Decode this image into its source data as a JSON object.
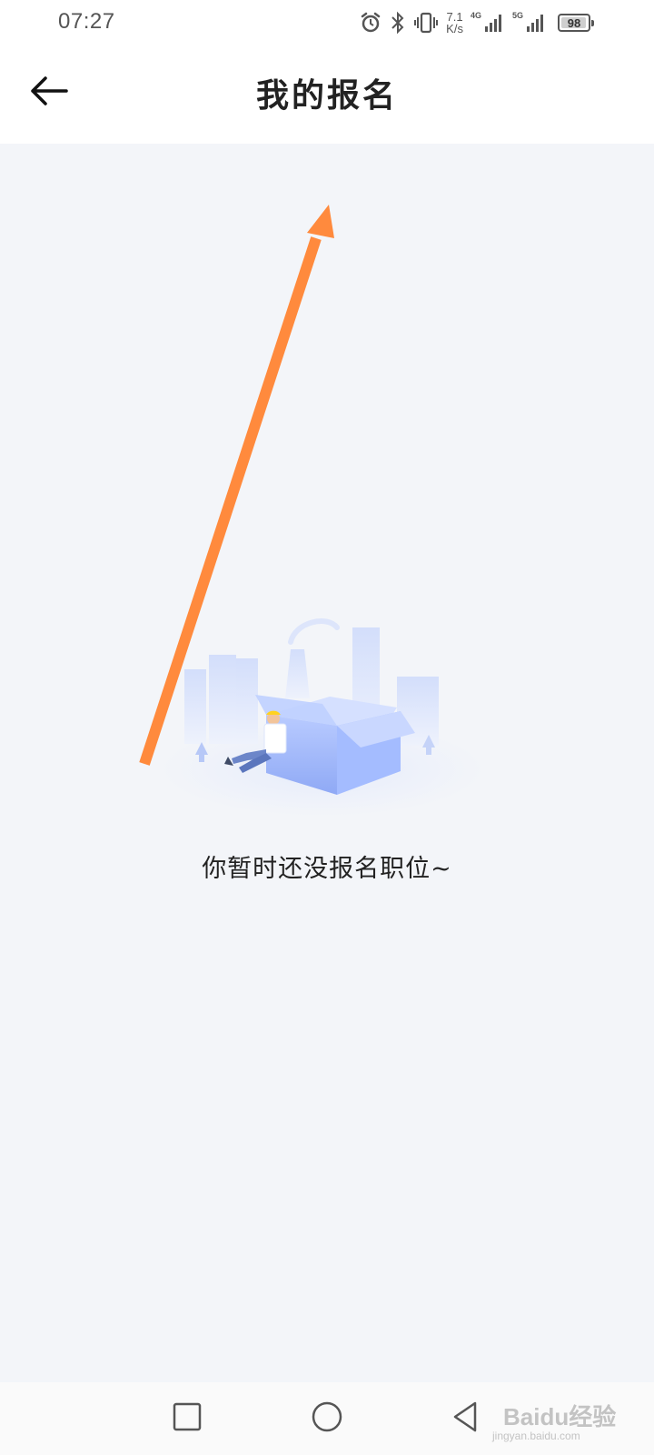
{
  "status_bar": {
    "time": "07:27",
    "net_speed_value": "7.1",
    "net_speed_unit": "K/s",
    "signal1_label": "4G",
    "signal2_label": "5G",
    "battery_level": "98",
    "icons": [
      "alarm-icon",
      "bluetooth-icon",
      "vibrate-icon",
      "signal-icon",
      "signal-icon",
      "battery-icon"
    ]
  },
  "header": {
    "title": "我的报名",
    "back_icon": "arrow-left-icon"
  },
  "main": {
    "empty_message": "你暂时还没报名职位~",
    "annotation_color": "#ff8a3d"
  },
  "nav_bar": {
    "icons": [
      "square-recents-icon",
      "circle-home-icon",
      "triangle-back-icon"
    ]
  },
  "watermark": {
    "brand": "Baidu经验",
    "url": "jingyan.baidu.com"
  },
  "colors": {
    "background": "#f3f5f9",
    "header_bg": "#ffffff",
    "title_text": "#222222",
    "illustration_blue": "#a9c0ff"
  }
}
